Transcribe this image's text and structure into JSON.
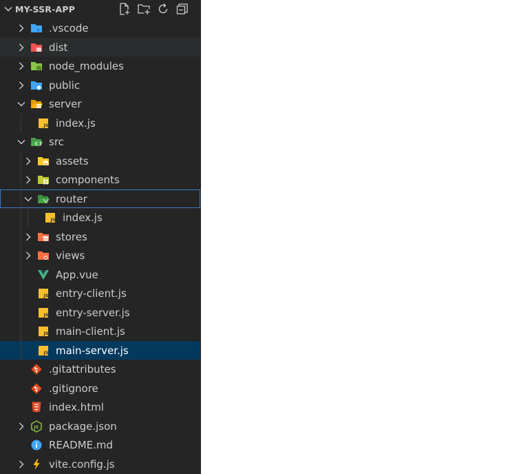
{
  "explorer": {
    "title": "MY-SSR-APP",
    "actions": [
      {
        "name": "new-file-icon"
      },
      {
        "name": "new-folder-icon"
      },
      {
        "name": "refresh-icon"
      },
      {
        "name": "collapse-all-icon"
      }
    ],
    "items": [
      {
        "label": ".vscode",
        "type": "folder",
        "expanded": false,
        "depth": 0,
        "icon": "folder-vscode-icon",
        "color": "#42a5f5"
      },
      {
        "label": "dist",
        "type": "folder",
        "expanded": false,
        "depth": 0,
        "icon": "folder-dist-icon",
        "color": "#ef5350",
        "state": "hover"
      },
      {
        "label": "node_modules",
        "type": "folder",
        "expanded": false,
        "depth": 0,
        "icon": "folder-node-icon",
        "color": "#8bc34a"
      },
      {
        "label": "public",
        "type": "folder",
        "expanded": false,
        "depth": 0,
        "icon": "folder-public-icon",
        "color": "#42a5f5"
      },
      {
        "label": "server",
        "type": "folder",
        "expanded": true,
        "depth": 0,
        "icon": "folder-server-open-icon",
        "color": "#ffb300"
      },
      {
        "label": "index.js",
        "type": "file",
        "depth": 1,
        "icon": "javascript-file-icon",
        "color": "#fbc02d"
      },
      {
        "label": "src",
        "type": "folder",
        "expanded": true,
        "depth": 0,
        "icon": "folder-src-open-icon",
        "color": "#4caf50"
      },
      {
        "label": "assets",
        "type": "folder",
        "expanded": false,
        "depth": 1,
        "icon": "folder-assets-icon",
        "color": "#ffca28"
      },
      {
        "label": "components",
        "type": "folder",
        "expanded": false,
        "depth": 1,
        "icon": "folder-components-icon",
        "color": "#c0ca33"
      },
      {
        "label": "router",
        "type": "folder",
        "expanded": true,
        "depth": 1,
        "icon": "folder-router-open-icon",
        "color": "#43a047",
        "state": "focused"
      },
      {
        "label": "index.js",
        "type": "file",
        "depth": 2,
        "icon": "javascript-file-icon",
        "color": "#fbc02d"
      },
      {
        "label": "stores",
        "type": "folder",
        "expanded": false,
        "depth": 1,
        "icon": "folder-stores-icon",
        "color": "#ff7043"
      },
      {
        "label": "views",
        "type": "folder",
        "expanded": false,
        "depth": 1,
        "icon": "folder-views-icon",
        "color": "#ff7043"
      },
      {
        "label": "App.vue",
        "type": "file",
        "depth": 1,
        "icon": "vue-file-icon",
        "color": "#41b883"
      },
      {
        "label": "entry-client.js",
        "type": "file",
        "depth": 1,
        "icon": "javascript-file-icon",
        "color": "#fbc02d"
      },
      {
        "label": "entry-server.js",
        "type": "file",
        "depth": 1,
        "icon": "javascript-file-icon",
        "color": "#fbc02d"
      },
      {
        "label": "main-client.js",
        "type": "file",
        "depth": 1,
        "icon": "javascript-file-icon",
        "color": "#fbc02d"
      },
      {
        "label": "main-server.js",
        "type": "file",
        "depth": 1,
        "icon": "javascript-file-icon",
        "color": "#fbc02d",
        "state": "selected"
      },
      {
        "label": ".gitattributes",
        "type": "file",
        "depth": 0,
        "icon": "git-file-icon",
        "color": "#e64a19"
      },
      {
        "label": ".gitignore",
        "type": "file",
        "depth": 0,
        "icon": "git-file-icon",
        "color": "#e64a19"
      },
      {
        "label": "index.html",
        "type": "file",
        "depth": 0,
        "icon": "html-file-icon",
        "color": "#e44d26"
      },
      {
        "label": "package.json",
        "type": "folder-like-file",
        "expanded": false,
        "depth": 0,
        "icon": "nodejs-file-icon",
        "color": "#8bc34a"
      },
      {
        "label": "README.md",
        "type": "file",
        "depth": 0,
        "icon": "info-file-icon",
        "color": "#42a5f5"
      },
      {
        "label": "vite.config.js",
        "type": "folder-like-file",
        "expanded": false,
        "depth": 0,
        "icon": "vite-file-icon",
        "color": "#ffc107"
      }
    ]
  }
}
